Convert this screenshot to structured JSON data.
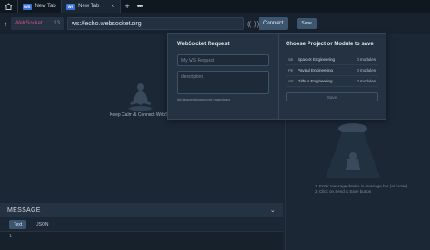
{
  "tabs": [
    {
      "badge": "WS",
      "label": "New Tab",
      "active": false
    },
    {
      "badge": "WS",
      "label": "New Tab",
      "active": true
    }
  ],
  "tab_close": "×",
  "tab_add": "+",
  "tab_more": "•••",
  "url_row": {
    "protocol": "WebSocket",
    "protocol_count": "13",
    "url": "ws://echo.websocket.org",
    "connect_label": "Connect",
    "save_label": "Save"
  },
  "left": {
    "calm_text": "Keep Calm & Connect WebSo"
  },
  "right": {
    "instructions": [
      "1. Enter message details in message bar (at footer)",
      "2. Click on Send & Save button"
    ]
  },
  "message": {
    "title": "MESSAGE",
    "tabs": [
      "Text",
      "JSON"
    ],
    "active_tab": "Text",
    "line_number": "1"
  },
  "popup": {
    "request_title": "WebSocket Request",
    "name_placeholder": "My WS Request",
    "description_placeholder": "description",
    "markdown_hint": "## description support markdown",
    "project_title": "Choose Project or Module to save",
    "projects": [
      {
        "badge": "SE",
        "name": "SpaceX Engineering",
        "count": "0 modules"
      },
      {
        "badge": "PE",
        "name": "Paypal Engineering",
        "count": "0 modules"
      },
      {
        "badge": "GE",
        "name": "Github Engineering",
        "count": "0 modules"
      }
    ],
    "save_label": "Save"
  },
  "colors": {
    "background": "#1b2735",
    "protocol_accent": "#d14e7a",
    "button": "#3d5670",
    "badge": "#3a74d8"
  }
}
